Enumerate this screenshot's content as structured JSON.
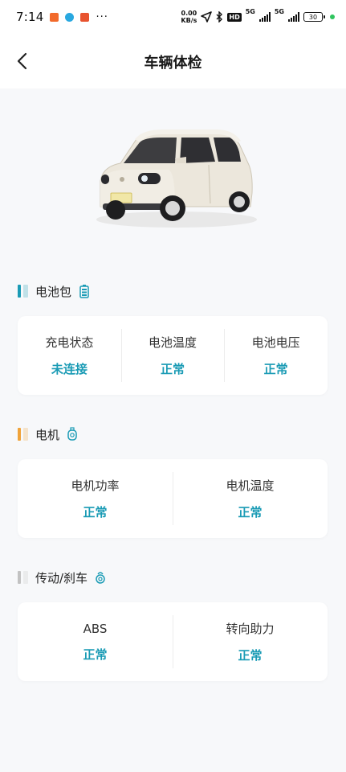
{
  "status_bar": {
    "time": "7:14",
    "more": "···",
    "net_speed_value": "0.00",
    "net_speed_unit": "KB/s",
    "hd_label": "HD",
    "sim1_tag": "5G",
    "sim2_tag": "5G",
    "battery_level": "30",
    "icons": [
      "app-notification-icon",
      "app-notification-icon",
      "app-notification-icon",
      "location-arrow-icon",
      "bluetooth-icon",
      "signal-icon",
      "battery-icon"
    ],
    "app_icon_colors": [
      "#f26a2b",
      "#29a8e0",
      "#e8532f"
    ],
    "charge_dot_color": "#2fc45e"
  },
  "nav": {
    "title": "车辆体检",
    "back_icon": "chevron-left-icon"
  },
  "sections": [
    {
      "title": "电池包",
      "icon": "battery-pack-icon",
      "accent": "#1a9bb5",
      "items": [
        {
          "label": "充电状态",
          "value": "未连接"
        },
        {
          "label": "电池温度",
          "value": "正常"
        },
        {
          "label": "电池电压",
          "value": "正常"
        }
      ]
    },
    {
      "title": "电机",
      "icon": "motor-icon",
      "accent": "#f0a33a",
      "items": [
        {
          "label": "电机功率",
          "value": "正常"
        },
        {
          "label": "电机温度",
          "value": "正常"
        }
      ]
    },
    {
      "title": "传动/刹车",
      "icon": "brake-icon",
      "accent": "#c2c2c2",
      "items": [
        {
          "label": "ABS",
          "value": "正常"
        },
        {
          "label": "转向助力",
          "value": "正常"
        }
      ]
    }
  ],
  "colors": {
    "status_value": "#1a9bb5",
    "background": "#f7f8fa"
  }
}
